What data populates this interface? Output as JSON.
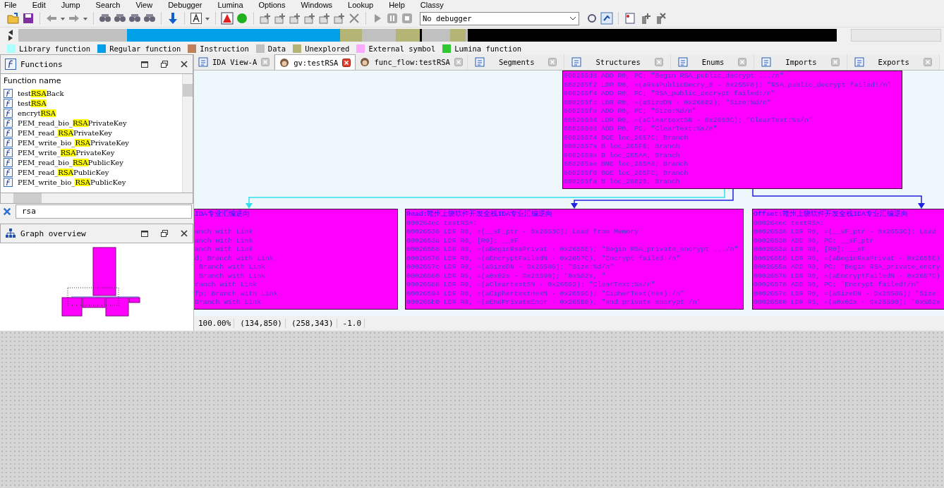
{
  "menu": [
    "File",
    "Edit",
    "Jump",
    "Search",
    "View",
    "Debugger",
    "Lumina",
    "Options",
    "Windows",
    "Lookup",
    "Help",
    "Classy"
  ],
  "toolbar": {
    "debugger": "No debugger"
  },
  "legend": [
    {
      "label": "Library function",
      "color": "#aaffff"
    },
    {
      "label": "Regular function",
      "color": "#00a0e8"
    },
    {
      "label": "Instruction",
      "color": "#c08060"
    },
    {
      "label": "Data",
      "color": "#c0c0c0"
    },
    {
      "label": "Unexplored",
      "color": "#b4b474"
    },
    {
      "label": "External symbol",
      "color": "#ffaaff"
    },
    {
      "label": "Lumina function",
      "color": "#30c830"
    }
  ],
  "functions_panel": {
    "title": "Functions",
    "column": "Function name",
    "filter": "rsa",
    "items": [
      {
        "pre": "test",
        "match": "RSA",
        "post": "Back"
      },
      {
        "pre": "test",
        "match": "RSA"
      },
      {
        "pre": "encryt",
        "match": "RSA"
      },
      {
        "pre": "PEM_read_bio_",
        "match": "RSA",
        "post": "PrivateKey"
      },
      {
        "pre": "PEM_read_",
        "match": "RSA",
        "post": "PrivateKey"
      },
      {
        "pre": "PEM_write_bio_",
        "match": "RSA",
        "post": "PrivateKey"
      },
      {
        "pre": "PEM_write_",
        "match": "RSA",
        "post": "PrivateKey"
      },
      {
        "pre": "PEM_read_bio_",
        "match": "RSA",
        "post": "PublicKey"
      },
      {
        "pre": "PEM_read_",
        "match": "RSA",
        "post": "PublicKey"
      },
      {
        "pre": "PEM_write_bio_",
        "match": "RSA",
        "post": "PublicKey"
      }
    ]
  },
  "overview_panel": {
    "title": "Graph overview"
  },
  "tabs": [
    {
      "label": "IDA View-A",
      "selected": false
    },
    {
      "label": "gv:testRSA",
      "selected": true
    },
    {
      "label": "func_flow:testRSA",
      "selected": false
    },
    {
      "label": "Segments",
      "selected": false
    },
    {
      "label": "Structures",
      "selected": false
    },
    {
      "label": "Enums",
      "selected": false
    },
    {
      "label": "Imports",
      "selected": false
    },
    {
      "label": "Exports",
      "selected": false
    }
  ],
  "graph": {
    "nodes": [
      {
        "lines": [
          "000265d8 ADD R0, PC; \"Begin RSA_public_decrypt .../n\"",
          "000265f2 LDR R0, =(aRsaPublicDecry_0 - 0x265F8); \"RSA_public_decrypt failed!/n\"",
          "000265f4 ADD R0, PC; \"RSA_public_decrypt failed!/n\"",
          "000265fc LDR R0, =(aSizeDN - 0x26602); \"Size:%d/n\"",
          "000265fe ADD R0, PC; \"Size:%d/n\"",
          "00026604 LDR R0, =(aCleartextSN - 0x2660C); \"ClearText:%s/n\"",
          "00026608 ADD R0, PC; \"ClearText:%s/n\"",
          "00026574 BGE loc_2657C; Branch",
          "0002657a B loc_265F6; Branch",
          "0002659e B loc_265AA; Branch",
          "000265ae BNE loc_265A0; Branch",
          "000265f0 BGE loc_265FC; Branch",
          "000265fa B loc_26620; Branch"
        ]
      },
      {
        "title": "IDA专业汇编逆向",
        "lines": [
          "anch with Link",
          "anch with Link",
          "anch with Link",
          "d; Branch with Link",
          " Branch with Link",
          " Branch with Link",
          "ranch with Link",
          "fp; Branch with Link",
          "Branch with Link"
        ]
      },
      {
        "title": "Read:赣州上饶软件开发全栈IDA专业汇编逆向",
        "lines": [
          "000264ec testRSA:",
          "00026536 LDR R0, =(__sF_ptr - 0x2653C); Load from Memory",
          "0002653a LDR R0, [R0]; __sF",
          "00026558 LDR R0, =(aBeginRsaPrivat - 0x2655E); \"Begin RSA_private_encrypt .../n\"",
          "00026576 LDR R0, =(aEncryptFailedN - 0x2657C); \"Encrypt failed!/n\"",
          "0002657c LDR R0, =(aSizeDN - 0x26586); \"Size:%d/n\"",
          "00026580 LDR R5, =(a0x02x - 0x26590); \"0x%02x, \"",
          "00026588 LDR R0, =(aCleartextSN - 0x26592); \"ClearText:%s/n\"",
          "00026594 LDR R0, =(aCiphertextHexN - 0x2659C); \"CipherText(Hex):/n\"",
          "000265b0 LDR R0, =(aEndPrivateEncr - 0x265B6); \"end private encrypt /n\""
        ]
      },
      {
        "title": "Offset:赣州上饶软件开发全栈IDA专业汇编逆向",
        "lines": [
          "000264ec testRSA:",
          "00026536 LDR R0, =(__sF_ptr - 0x2653C); Load",
          "00026538 ADD R0, PC; __sF_ptr",
          "0002653a LDR R0, [R0]; __sF",
          "00026558 LDR R0, =(aBeginRsaPrivat - 0x2655E)",
          "0002655a ADD R0, PC; \"Begin RSA_private_encry",
          "00026576 LDR R0, =(aEncryptFailedN - 0x2657C)",
          "00026578 ADD R0, PC; \"Encrypt failed!/n\"",
          "0002657c LDR R0, =(aSizeDN - 0x26586); \"Size:",
          "00026580 LDR R5, =(a0x02x - 0x26590); \"0x%02x"
        ]
      }
    ],
    "status": [
      "100.00%",
      "(134,850)",
      "(258,343)",
      "-1.0"
    ]
  }
}
